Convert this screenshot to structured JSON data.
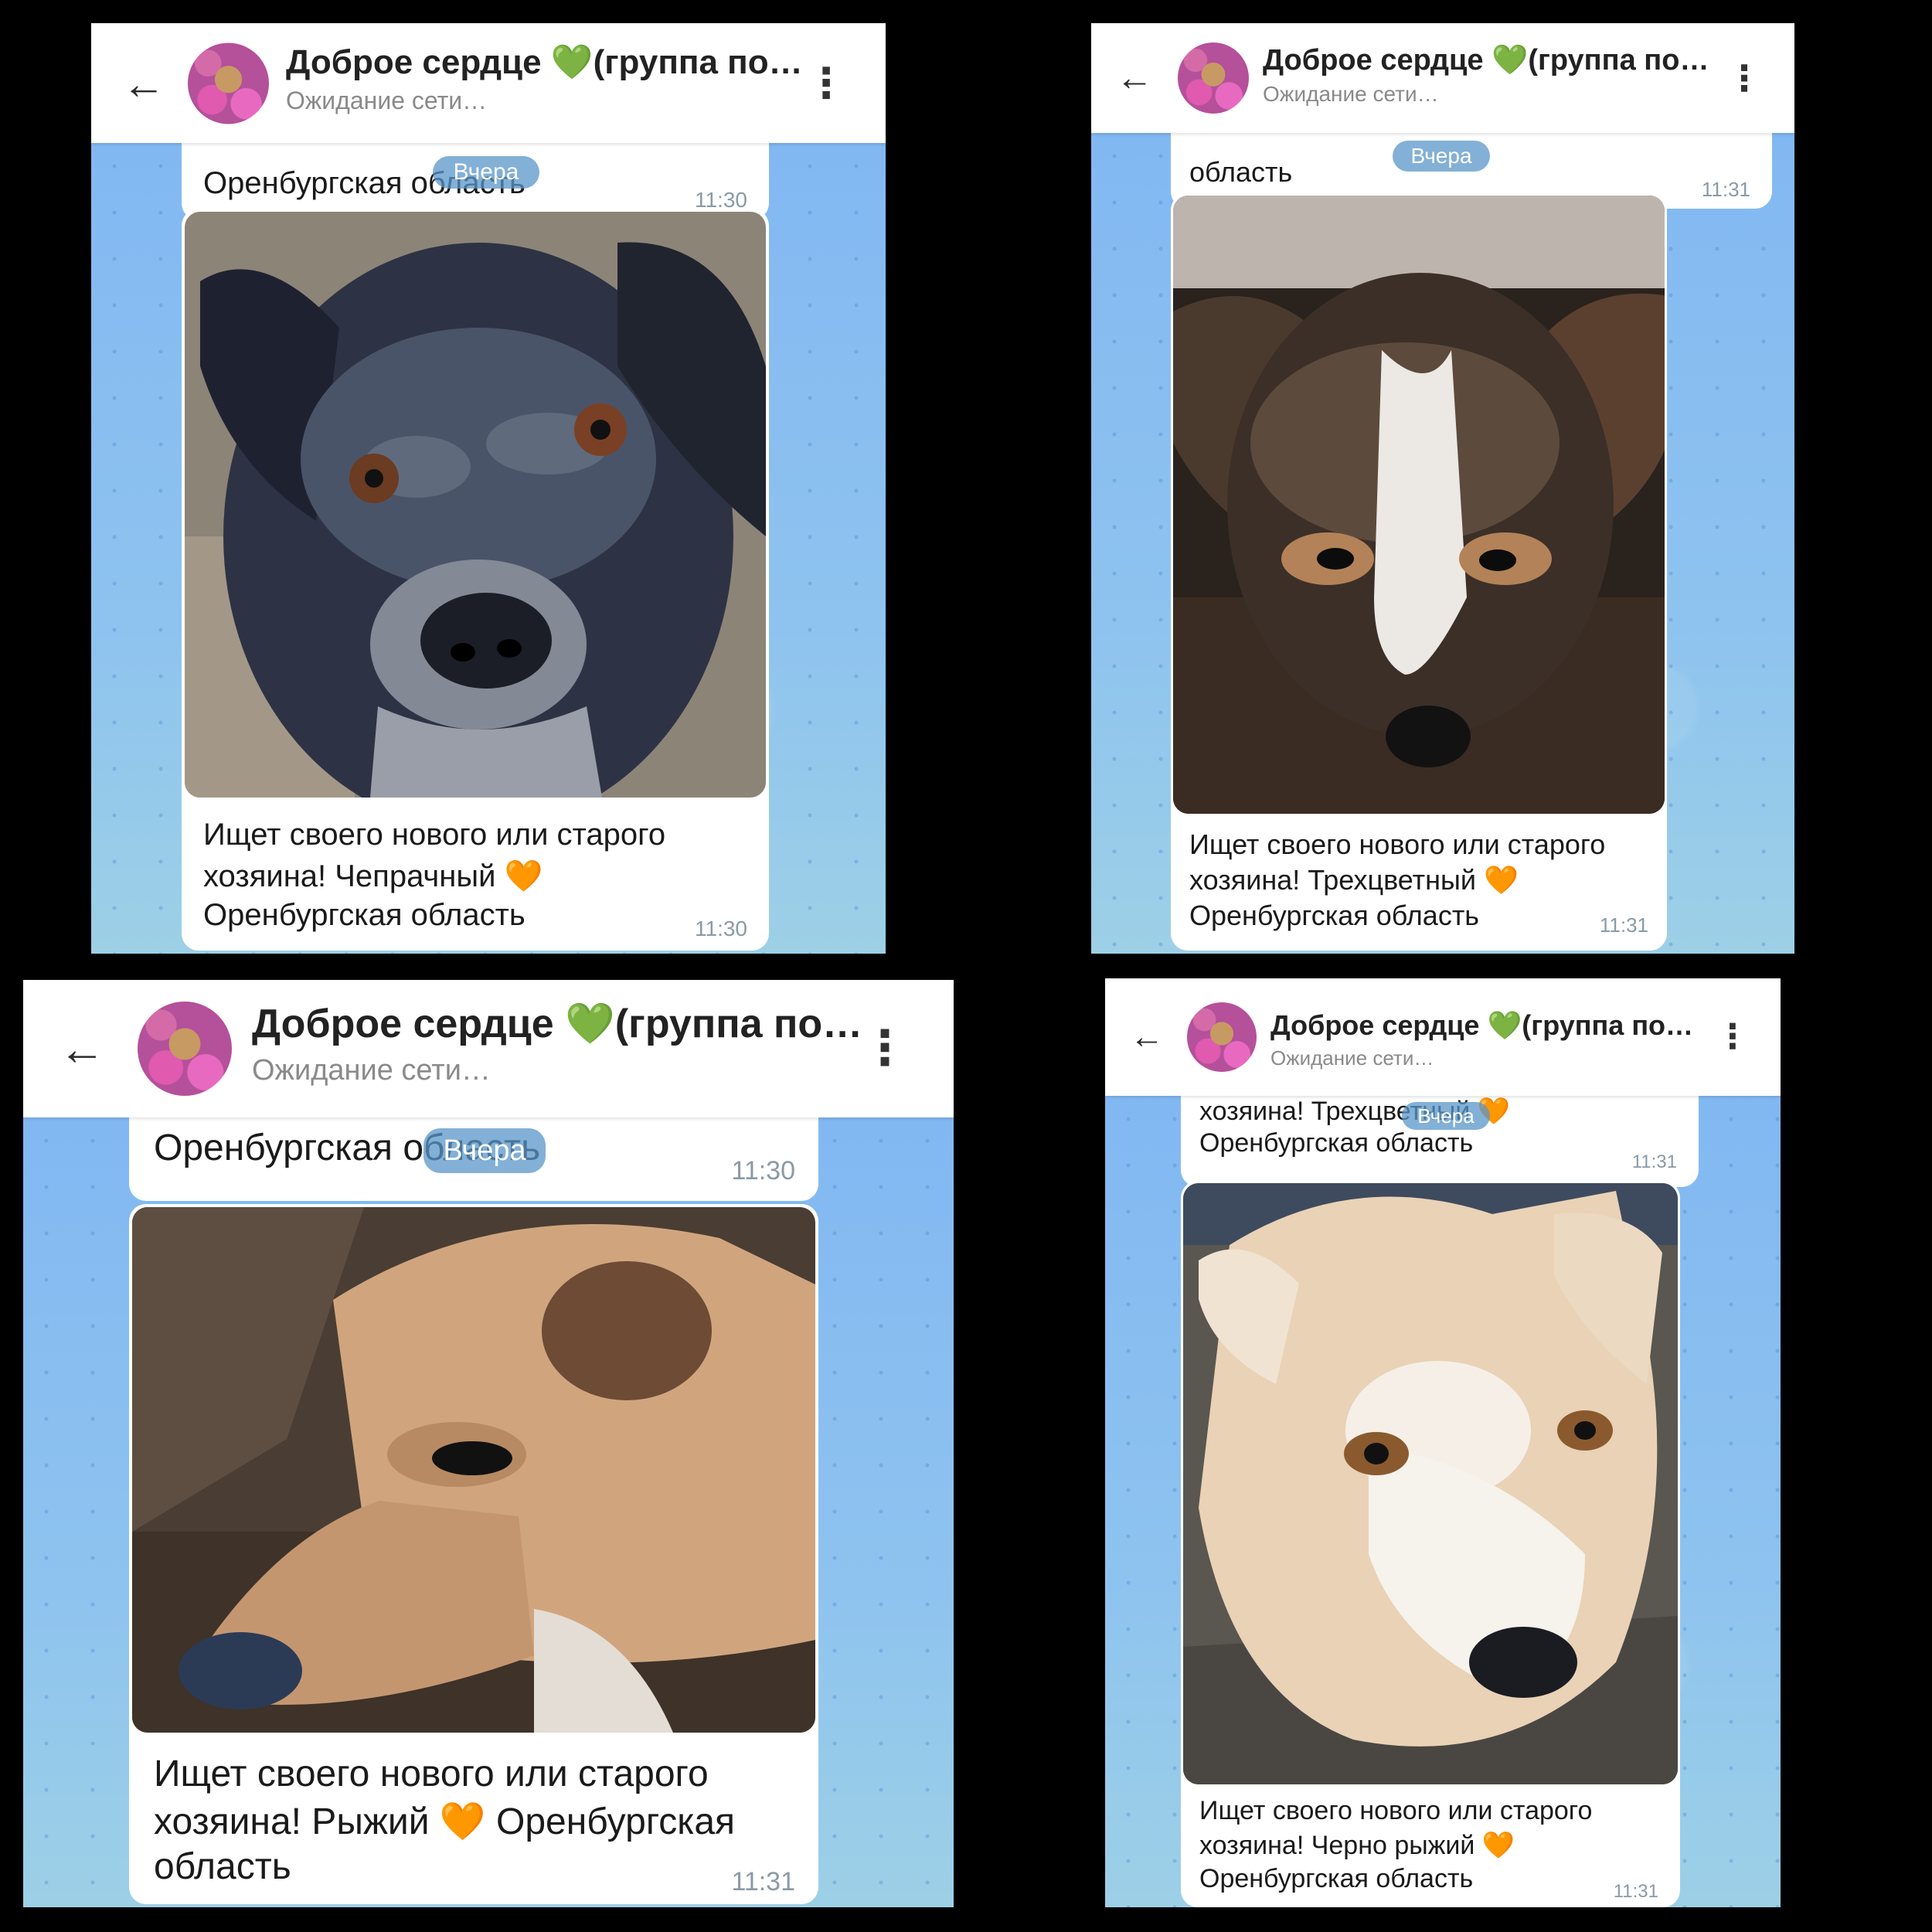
{
  "chat": {
    "title": "Доброе сердце 💚(группа по…",
    "status": "Ожидание сети…",
    "date_chip": "Вчера"
  },
  "panels": [
    {
      "prev_text": "Оренбургская область",
      "prev_time": "11:30",
      "caption_lines": [
        "Ищет своего нового или старого",
        "хозяина! Чепрачный 🧡",
        "Оренбургская область"
      ],
      "time": "11:30",
      "photo_desc": "dog-black-gray"
    },
    {
      "prev_text": "область",
      "prev_time": "11:31",
      "caption_lines": [
        "Ищет своего нового или старого",
        "хозяина! Трехцветный 🧡",
        "Оренбургская область"
      ],
      "time": "11:31",
      "photo_desc": "dog-tricolor"
    },
    {
      "prev_text": "Оренбургская область",
      "prev_time": "11:30",
      "caption_lines": [
        "Ищет своего нового или старого",
        "хозяина! Рыжий 🧡 Оренбургская",
        "область"
      ],
      "time": "11:31",
      "photo_desc": "dog-ginger"
    },
    {
      "prev_text_lines": [
        "хозяина! Трехцветный 🧡",
        "Оренбургская область"
      ],
      "prev_time": "11:31",
      "caption_lines": [
        "Ищет своего нового или старого",
        "хозяина! Черно рыжий 🧡",
        "Оренбургская область"
      ],
      "time": "11:31",
      "photo_desc": "dog-cream"
    }
  ]
}
